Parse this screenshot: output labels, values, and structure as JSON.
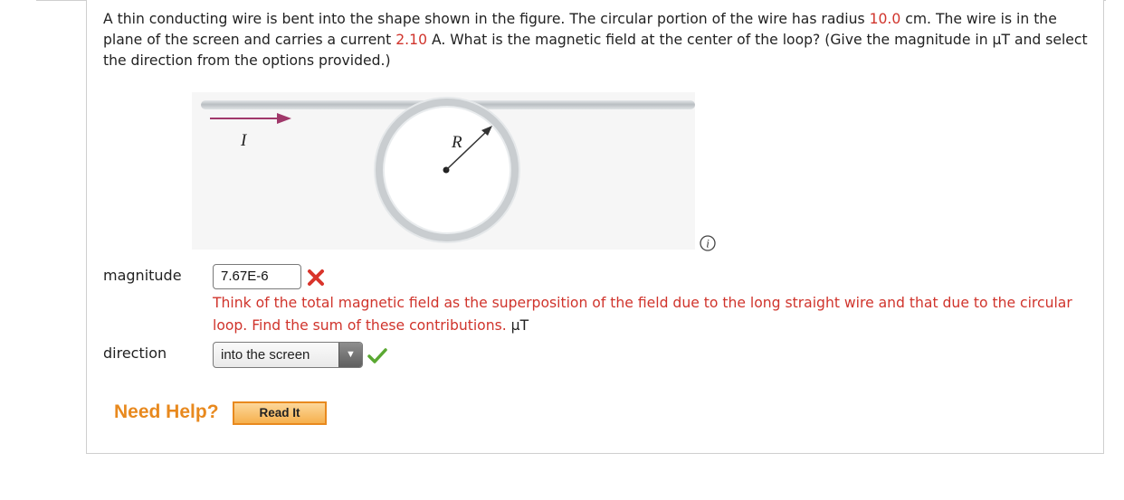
{
  "question": {
    "text_before_radius": "A thin conducting wire is bent into the shape shown in the figure. The circular portion of the wire has radius ",
    "radius_value": "10.0",
    "text_after_radius": " cm. The wire is in the plane of the screen and carries a current ",
    "current_value": "2.10",
    "text_after_current": " A. What is the magnetic field at the center of the loop? (Give the magnitude in μT and select the direction from the options provided.)"
  },
  "figure": {
    "current_label": "I",
    "radius_label": "R",
    "arrow_color": "#a0386a"
  },
  "magnitude": {
    "label": "magnitude",
    "value": "7.67E-6",
    "status": "incorrect",
    "feedback": "Think of the total magnetic field as the superposition of the field due to the long straight wire and that due to the circular loop. Find the sum of these contributions.",
    "unit": "μT"
  },
  "direction": {
    "label": "direction",
    "selected": "into the screen",
    "status": "correct"
  },
  "help": {
    "title": "Need Help?",
    "read_it_label": "Read It"
  },
  "colors": {
    "error": "#d0342c",
    "correct": "#5aa832",
    "help_orange": "#e8891e"
  }
}
